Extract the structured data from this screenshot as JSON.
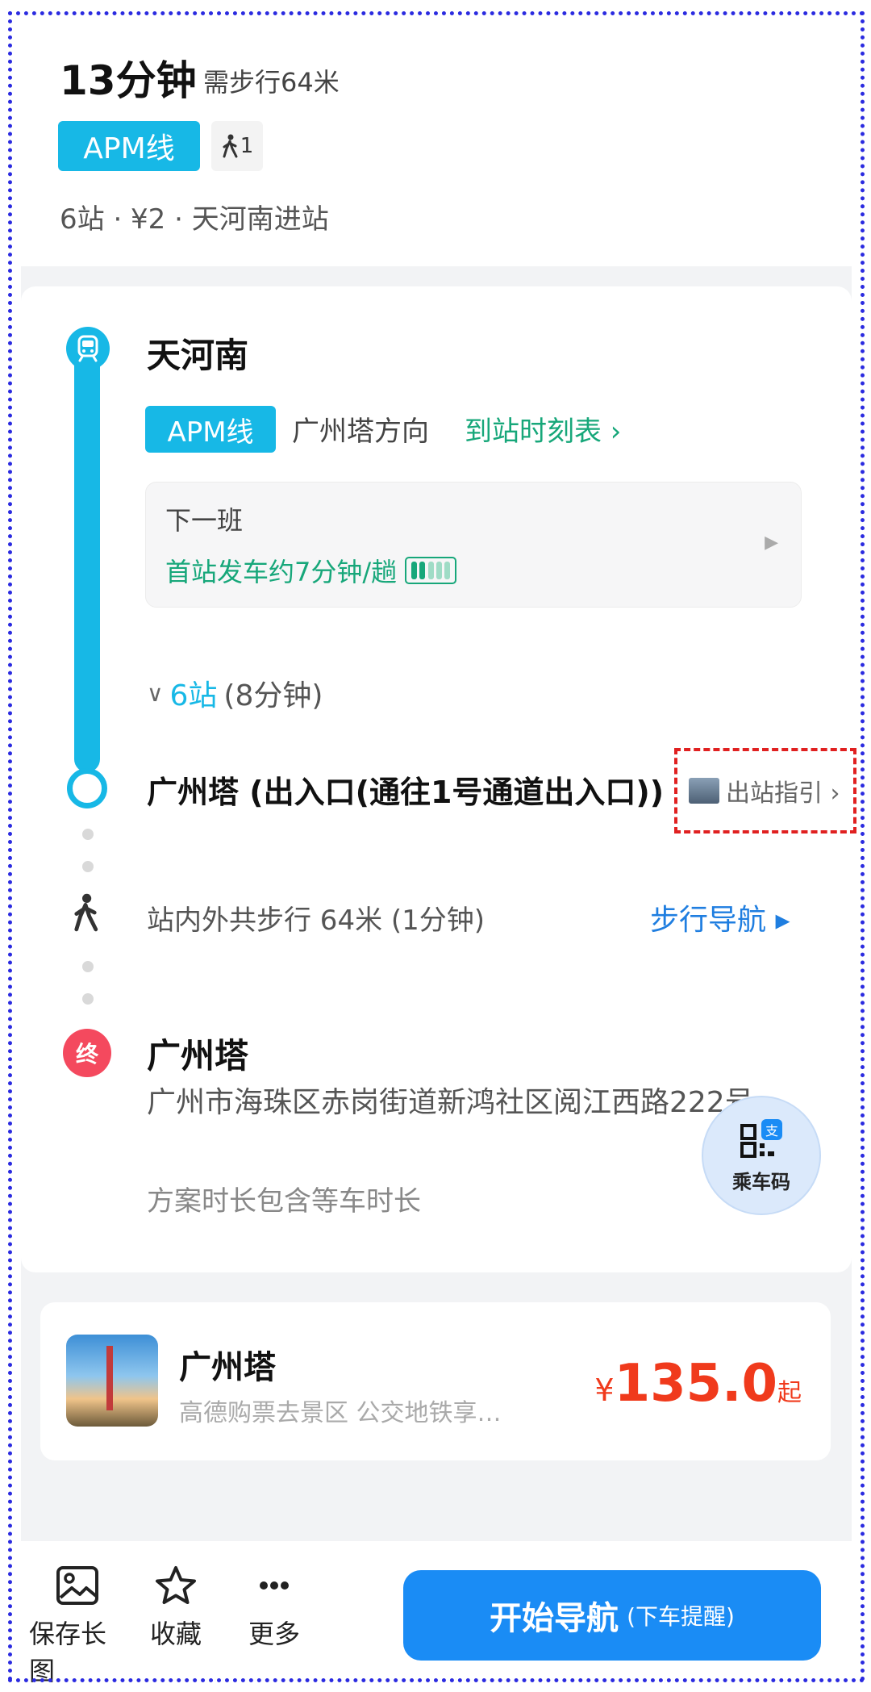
{
  "summary": {
    "duration": "13分钟",
    "walk_note": "需步行64米",
    "line_label": "APM线",
    "walk_count": "1",
    "meta": "6站 · ¥2 · 天河南进站"
  },
  "route": {
    "start_station": "天河南",
    "line_label": "APM线",
    "direction": "广州塔方向",
    "timetable_link": "到站时刻表 ›",
    "next_label": "下一班",
    "next_info": "首站发车约7分钟/趟",
    "stops_count": "6站",
    "stops_duration": "(8分钟)",
    "exit_station": "广州塔 (出入口(通往1号通道出入口))",
    "exit_guide": "出站指引 ›",
    "walk_text": "站内外共步行 64米 (1分钟)",
    "walk_nav": "步行导航 ▸",
    "end_badge": "终",
    "end_name": "广州塔",
    "end_address": "广州市海珠区赤岗街道新鸿社区阅江西路222号",
    "end_note": "方案时长包含等车时长"
  },
  "fab": {
    "label": "乘车码"
  },
  "attraction": {
    "name": "广州塔",
    "desc": "高德购票去景区 公交地铁享…",
    "currency": "¥",
    "price": "135.0",
    "price_suffix": "起"
  },
  "toolbar": {
    "save_label": "保存长图",
    "fav_label": "收藏",
    "more_label": "更多",
    "start_main": "开始导航",
    "start_sub": "(下车提醒)"
  },
  "colors": {
    "line": "#17b8e6",
    "accent_green": "#17a77a",
    "link_blue": "#1f7ee0",
    "price_red": "#f03a1c",
    "primary_button": "#1a8cf5",
    "end_badge": "#f4495e"
  }
}
